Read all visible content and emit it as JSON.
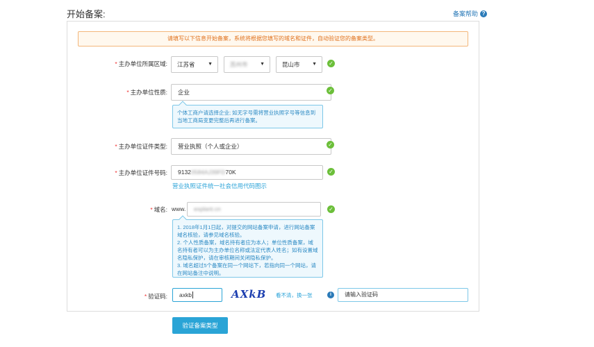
{
  "header": {
    "title": "开始备案:",
    "help_label": "备案帮助",
    "help_icon": "?"
  },
  "notice": {
    "text": "请填写以下信息开始备案，系统将根据您填写的域名和证件，自动验证您的备案类型。"
  },
  "form": {
    "region": {
      "label": "主办单位所属区域:",
      "province": "江苏省",
      "city": "苏州市",
      "district": "昆山市"
    },
    "org_nature": {
      "label": "主办单位性质:",
      "value": "企业",
      "tip": "个体工商户请选择企业; 如无字号需将营业执照字号等信息到当地工商局变更完整后再进行备案。"
    },
    "cert_type": {
      "label": "主办单位证件类型:",
      "value": "营业执照（个人或企业）"
    },
    "cert_number": {
      "label": "主办单位证件号码:",
      "value_prefix": "9132",
      "value_hidden": "0584AJ39FD",
      "value_suffix": "70K",
      "link": "营业执照证件统一社会信用代码图示"
    },
    "domain": {
      "label": "域名:",
      "prefix": "www.",
      "value": "explant.cn",
      "tips": [
        "1. 2018年1月1日起，对提交的网站备案申请，进行网站备案域名核验，请参见域名核验。",
        "2. 个人性质备案，域名持有者应为本人；单位性质备案，域名持有者可以为主办单位名称或法定代表人姓名；如有设置域名隐私保护，请在审核期间关闭隐私保护。",
        "3. 域名超过5个备案在同一个网站下，若指向同一个网站，请在网站备注中说明。"
      ]
    },
    "captcha": {
      "label": "验证码:",
      "input_value": "axkb",
      "image_text": "AXkB",
      "refresh_label": "看不清，换一张",
      "info_icon": "i",
      "hint_placeholder": "请输入验证码"
    }
  },
  "submit": {
    "label": "验证备案类型"
  },
  "icons": {
    "check": "✓",
    "caret": "▼"
  },
  "colors": {
    "accent": "#2aa4d6",
    "required_star": "#e33333",
    "notice_text": "#e0711c",
    "success": "#6cbf3a",
    "tip_text": "#2c8ac4"
  }
}
